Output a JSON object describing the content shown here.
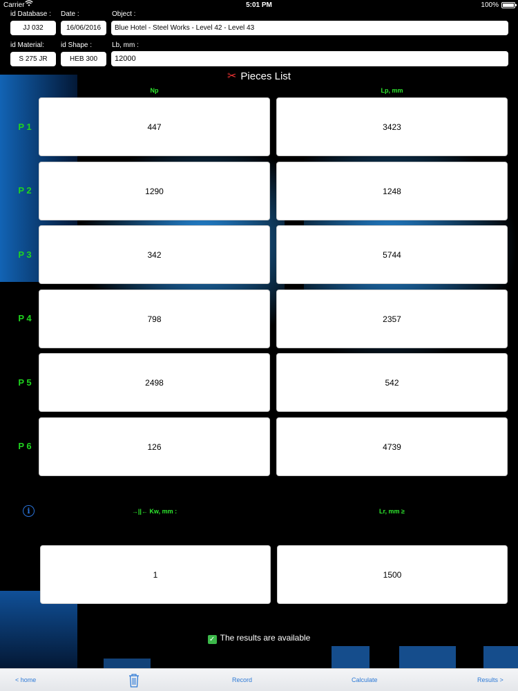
{
  "status": {
    "carrier": "Carrier",
    "time": "5:01 PM",
    "battery": "100%"
  },
  "header": {
    "id_database": {
      "label": "id Database :",
      "value": "JJ 032"
    },
    "date": {
      "label": "Date :",
      "value": "16/06/2016"
    },
    "object": {
      "label": "Object :",
      "value": "Blue Hotel - Steel Works - Level 42 - Level 43"
    },
    "id_material": {
      "label": "id Material:",
      "value": "S 275 JR"
    },
    "id_shape": {
      "label": "id Shape :",
      "value": "HEB 300"
    },
    "lb": {
      "label": "Lb, mm :",
      "value": "12000"
    }
  },
  "title": "Pieces List",
  "columns": {
    "np": "Np",
    "lp": "Lp, mm"
  },
  "pieces": [
    {
      "label": "P 1",
      "np": "447",
      "lp": "3423"
    },
    {
      "label": "P 2",
      "np": "1290",
      "lp": "1248"
    },
    {
      "label": "P 3",
      "np": "342",
      "lp": "5744"
    },
    {
      "label": "P 4",
      "np": "798",
      "lp": "2357"
    },
    {
      "label": "P 5",
      "np": "2498",
      "lp": "542"
    },
    {
      "label": "P 6",
      "np": "126",
      "lp": "4739"
    }
  ],
  "bottom": {
    "kw_label": "→||← Kw, mm :",
    "lr_label": "Lr, mm ≥",
    "kw_value": "1",
    "lr_value": "1500"
  },
  "results_text": "The results are available",
  "toolbar": {
    "home": "< home",
    "record": "Record",
    "calculate": "Calculate",
    "results": "Results >"
  },
  "colors": {
    "accent_green": "#2ee82e",
    "ios_blue": "#2e7ad6",
    "background": "#000000"
  }
}
